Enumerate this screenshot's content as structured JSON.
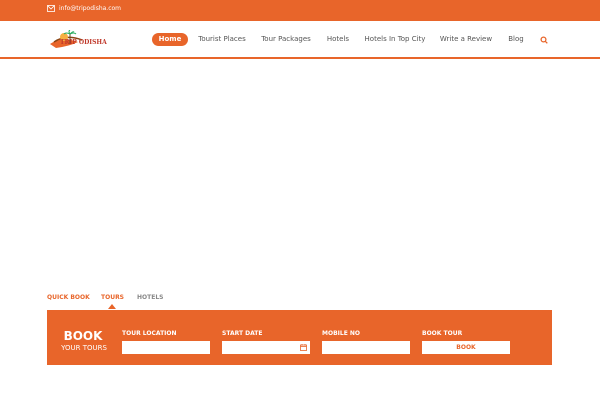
{
  "topbar": {
    "email": "info@tripodisha.com"
  },
  "logo": {
    "text": "TRIP ODISHA"
  },
  "nav": {
    "items": [
      {
        "label": "Home"
      },
      {
        "label": "Tourist Places"
      },
      {
        "label": "Tour Packages"
      },
      {
        "label": "Hotels"
      },
      {
        "label": "Hotels In Top City"
      },
      {
        "label": "Write a Review"
      },
      {
        "label": "Blog"
      }
    ],
    "search_icon": "search-icon"
  },
  "tabs": [
    {
      "label": "QUICK BOOK"
    },
    {
      "label": "TOURS"
    },
    {
      "label": "HOTELS"
    }
  ],
  "booking": {
    "title": "BOOK",
    "subtitle": "YOUR TOURS",
    "tour_location_label": "TOUR LOCATION",
    "start_date_label": "START DATE",
    "mobile_no_label": "MOBILE NO",
    "book_tour_label": "BOOK TOUR",
    "book_button": "BOOK"
  },
  "colors": {
    "accent": "#e8652a"
  }
}
